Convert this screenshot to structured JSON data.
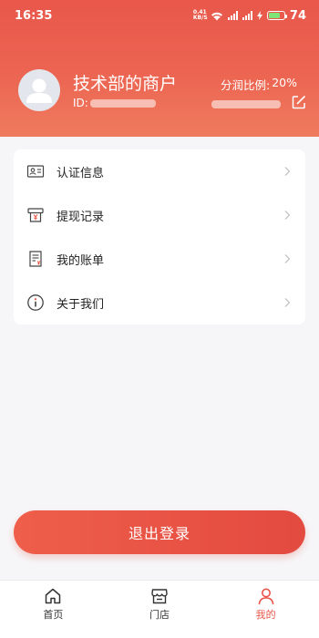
{
  "status_bar": {
    "time": "16:35",
    "net_speed_value": "0.41",
    "net_speed_unit": "KB/S",
    "battery": "74"
  },
  "profile": {
    "merchant_name": "技术部的商户",
    "id_label": "ID:",
    "share_label": "分润比例:",
    "share_value": "20%"
  },
  "menu": {
    "items": [
      {
        "label": "认证信息",
        "icon": "id-card-icon"
      },
      {
        "label": "提现记录",
        "icon": "withdraw-icon"
      },
      {
        "label": "我的账单",
        "icon": "bill-icon"
      },
      {
        "label": "关于我们",
        "icon": "info-icon"
      }
    ]
  },
  "logout_label": "退出登录",
  "tabbar": {
    "tabs": [
      {
        "label": "首页",
        "icon": "home-icon"
      },
      {
        "label": "门店",
        "icon": "store-icon"
      },
      {
        "label": "我的",
        "icon": "user-icon"
      }
    ],
    "active_color": "#e8574a"
  },
  "colors": {
    "header": "#e8574a",
    "background": "#f6f6f8",
    "battery_fill": "#7fe37a"
  }
}
